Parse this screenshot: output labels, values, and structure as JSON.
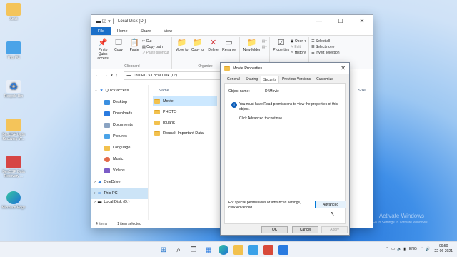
{
  "desktop": {
    "icons": [
      {
        "label": "Ankit"
      },
      {
        "label": "This PC"
      },
      {
        "label": "Recycle Bin"
      },
      {
        "label": "BenQSP Data Recovery W..."
      },
      {
        "label": "BenQSP Data Recovery ..."
      },
      {
        "label": "Microsoft Edge"
      }
    ]
  },
  "explorer": {
    "title": "Local Disk (D:)",
    "tabs": [
      "File",
      "Home",
      "Share",
      "View"
    ],
    "ribbon": {
      "clipboard": {
        "pin": "Pin to Quick access",
        "copy": "Copy",
        "paste": "Paste",
        "cut": "Cut",
        "copy_path": "Copy path",
        "paste_shortcut": "Paste shortcut",
        "group": "Clipboard"
      },
      "organize": {
        "move_to": "Move to",
        "copy_to": "Copy to",
        "delete": "Delete",
        "rename": "Rename",
        "group": "Organize"
      },
      "new": {
        "new_folder": "New folder"
      },
      "open": {
        "properties": "Properties",
        "open": "Open",
        "edit": "Edit",
        "history": "History"
      },
      "select": {
        "select_all": "Select all",
        "select_none": "Select none",
        "invert": "Invert selection"
      }
    },
    "address": {
      "path": "This PC  >  Local Disk (D:)"
    },
    "nav": [
      {
        "label": "Quick access"
      },
      {
        "label": "Desktop"
      },
      {
        "label": "Downloads"
      },
      {
        "label": "Documents"
      },
      {
        "label": "Pictures"
      },
      {
        "label": "Language"
      },
      {
        "label": "Music"
      },
      {
        "label": "Videos"
      },
      {
        "label": "OneDrive"
      },
      {
        "label": "This PC"
      },
      {
        "label": "Local Disk (D:)"
      }
    ],
    "column": {
      "name": "Name",
      "size": "Size"
    },
    "files": [
      {
        "name": "Movie"
      },
      {
        "name": "PHOTO"
      },
      {
        "name": "rouank"
      },
      {
        "name": "Rounak Important Data"
      }
    ],
    "status": {
      "items": "4 items",
      "selected": "1 item selected"
    }
  },
  "dialog": {
    "title": "Movie Properties",
    "tabs": [
      "General",
      "Sharing",
      "Security",
      "Previous Versions",
      "Customize"
    ],
    "object_label": "Object name:",
    "object_value": "D:\\Movie",
    "warning": "You must have Read permissions to view the properties of this object.",
    "advanced_hint": "Click Advanced to continue.",
    "special_text": "For special permissions or advanced settings, click Advanced.",
    "advanced_button": "Advanced",
    "ok": "OK",
    "cancel": "Cancel",
    "apply": "Apply"
  },
  "watermark": {
    "line1": "Activate Windows",
    "line2": "Go to Settings to activate Windows."
  },
  "taskbar": {
    "lang": "ENG",
    "time": "09:50",
    "date": "22-06-2021"
  }
}
